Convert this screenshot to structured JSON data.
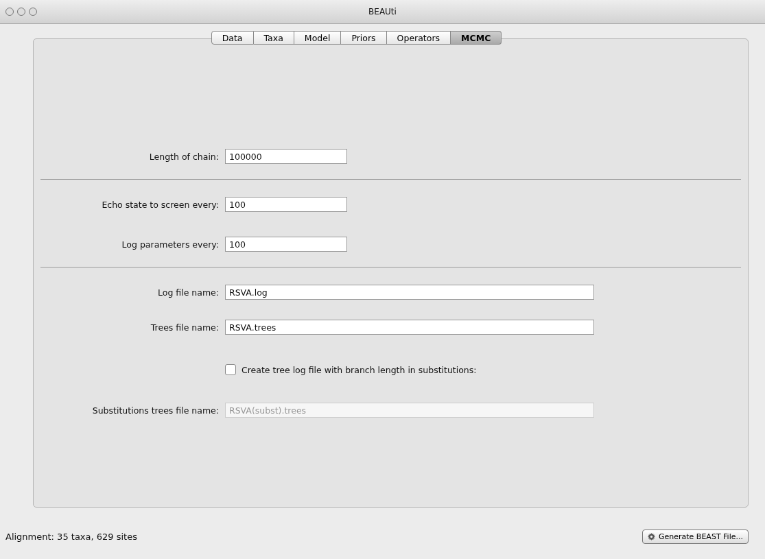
{
  "window": {
    "title": "BEAUti"
  },
  "tabs": [
    {
      "label": "Data",
      "selected": false
    },
    {
      "label": "Taxa",
      "selected": false
    },
    {
      "label": "Model",
      "selected": false
    },
    {
      "label": "Priors",
      "selected": false
    },
    {
      "label": "Operators",
      "selected": false
    },
    {
      "label": "MCMC",
      "selected": true
    }
  ],
  "rows": [
    {
      "kind": "number",
      "label": "Length of chain:",
      "value": "100000"
    },
    {
      "kind": "divider"
    },
    {
      "kind": "number",
      "label": "Echo state to screen every:",
      "value": "100"
    },
    {
      "kind": "number",
      "label": "Log parameters every:",
      "value": "100"
    },
    {
      "kind": "divider"
    },
    {
      "kind": "file",
      "label": "Log file name:",
      "value": "RSVA.log",
      "disabled": false
    },
    {
      "kind": "file",
      "label": "Trees file name:",
      "value": "RSVA.trees",
      "disabled": false
    },
    {
      "kind": "checkbox",
      "label": "Create tree log file with branch length in substitutions:",
      "checked": false
    },
    {
      "kind": "file",
      "label": "Substitutions trees file name:",
      "value": "RSVA(subst).trees",
      "disabled": true
    }
  ],
  "status": "Alignment: 35 taxa, 629 sites",
  "generate_button": "Generate BEAST File..."
}
